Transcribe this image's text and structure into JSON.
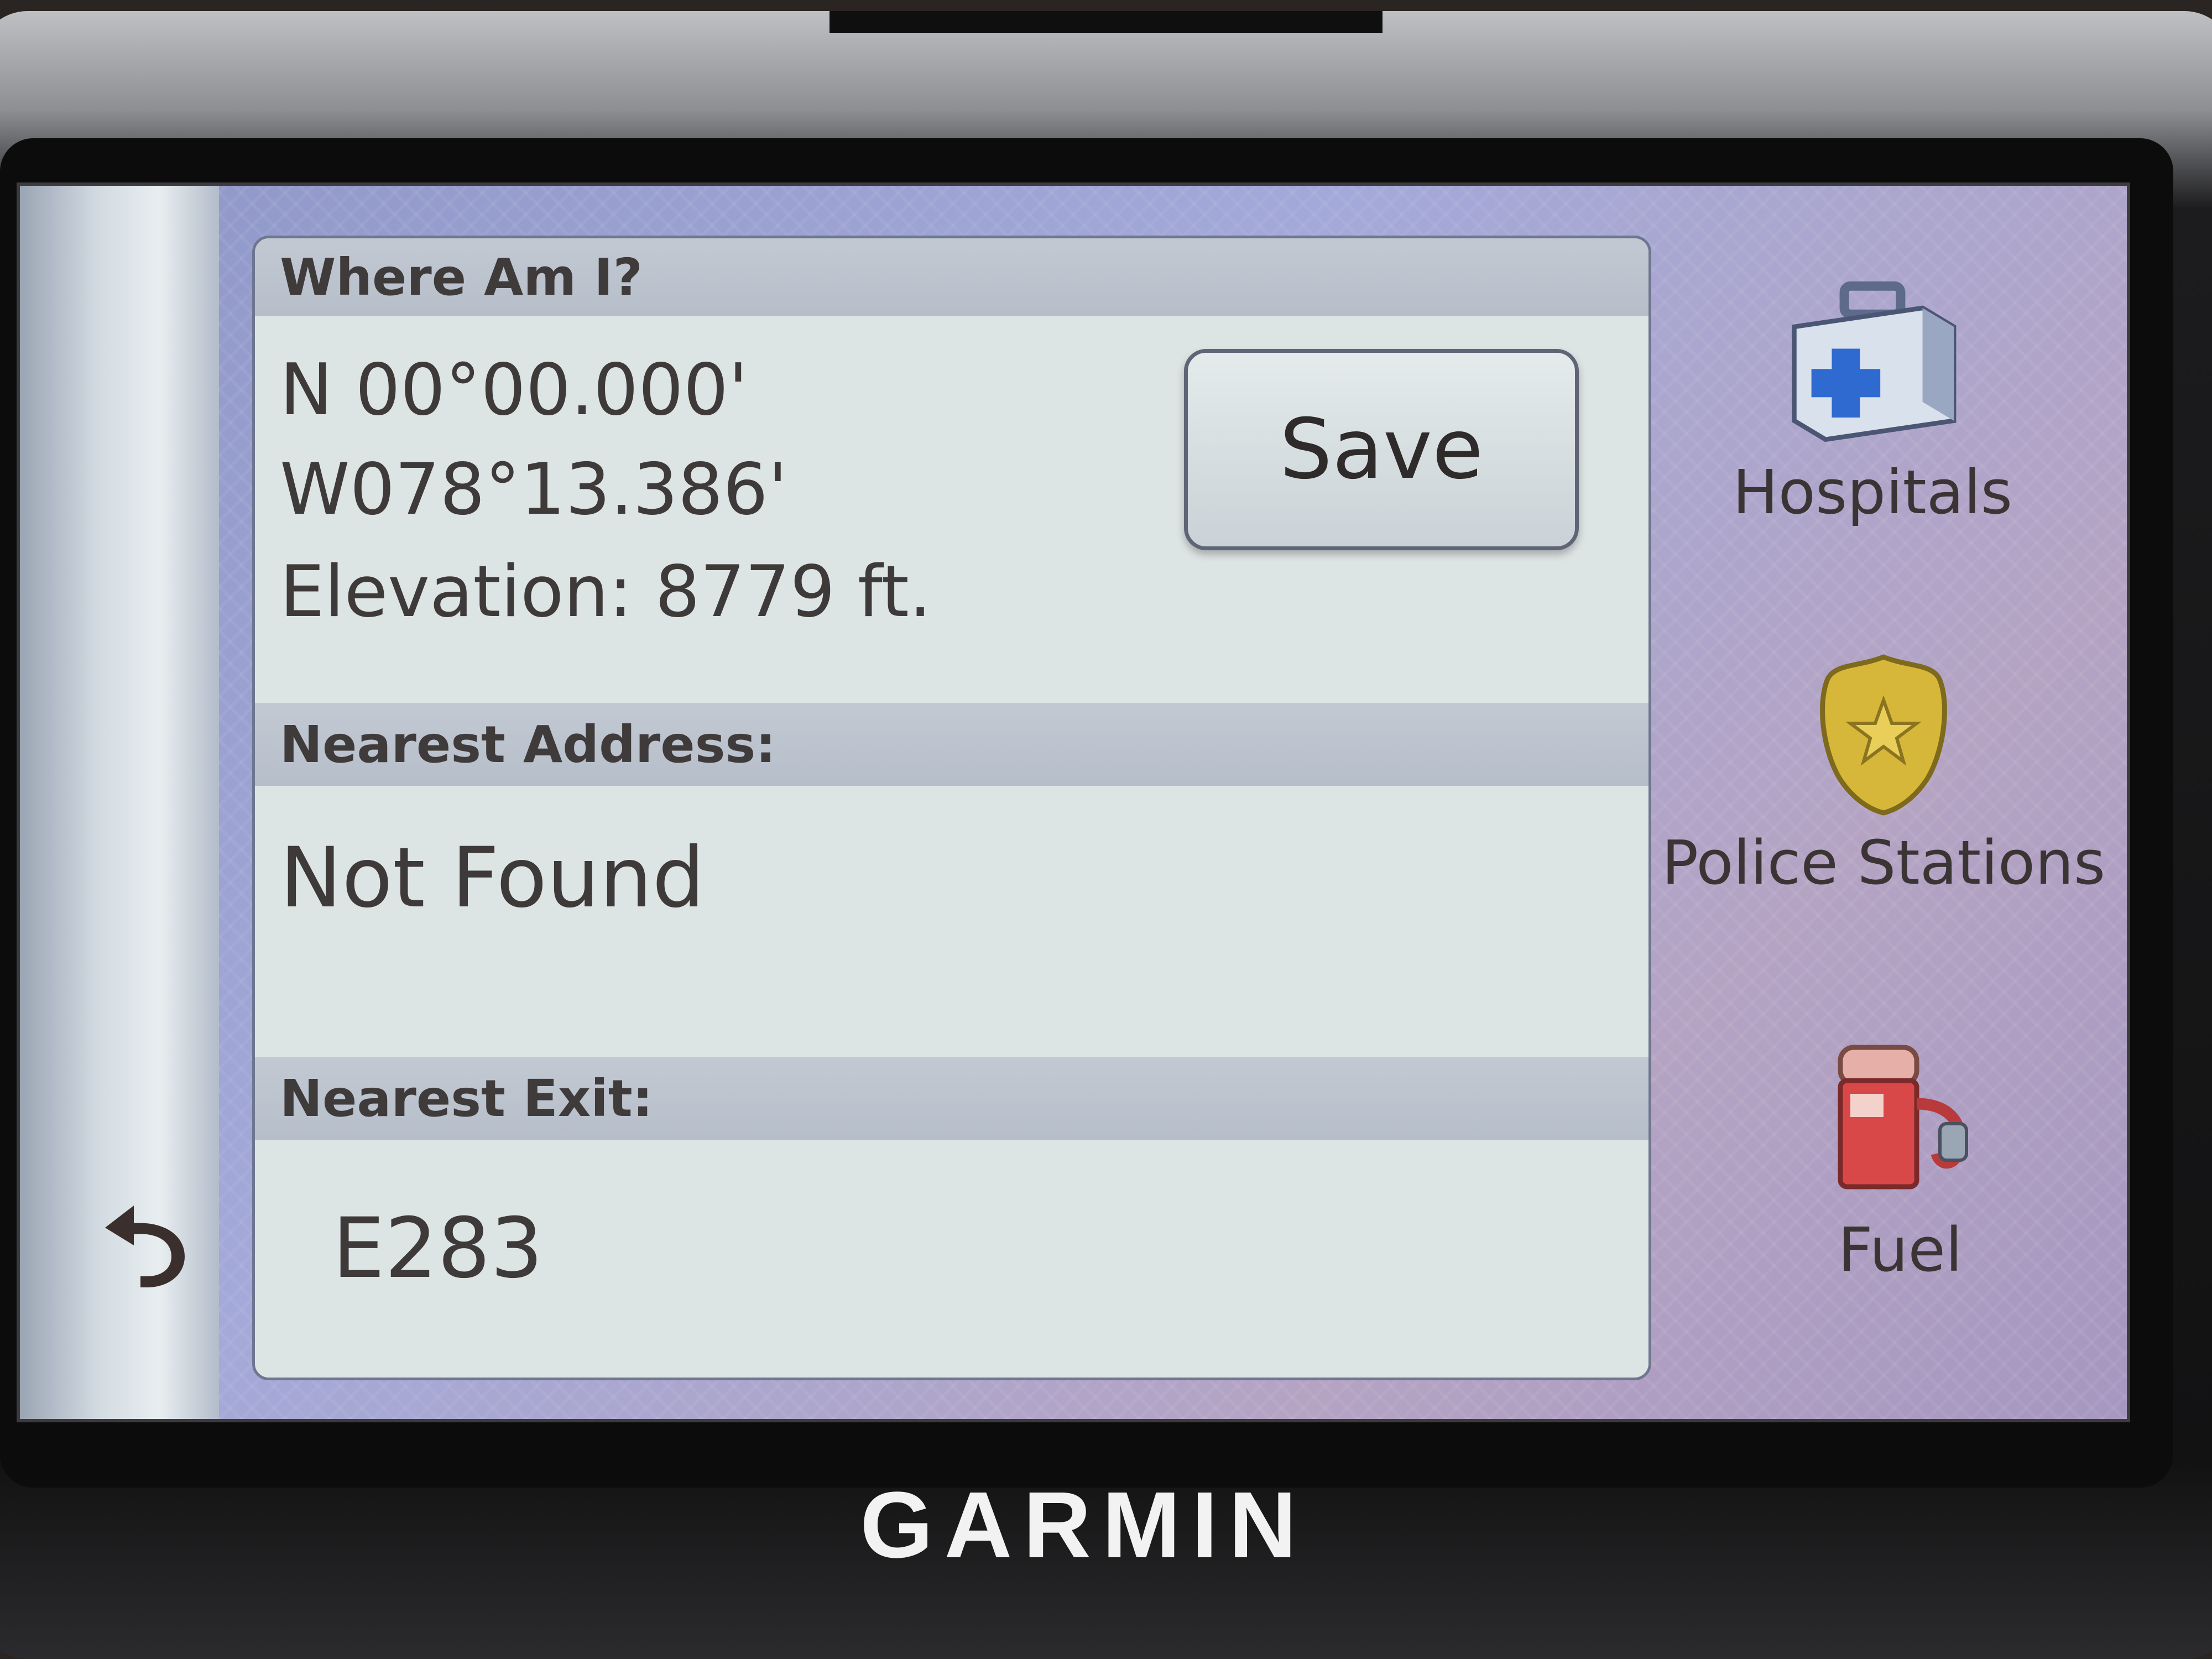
{
  "device": {
    "brand": "GARMIN"
  },
  "panel": {
    "where_header": "Where Am I?",
    "latitude": "N 00°00.000'",
    "longitude": "W078°13.386'",
    "elevation": "Elevation: 8779 ft.",
    "save_label": "Save",
    "address_header": "Nearest Address:",
    "address_value": "Not Found",
    "exit_header": "Nearest Exit:",
    "exit_value": "E283"
  },
  "sidebar": {
    "items": [
      {
        "label": "Hospitals",
        "icon": "first-aid-kit-icon"
      },
      {
        "label": "Police Stations",
        "icon": "police-badge-icon"
      },
      {
        "label": "Fuel",
        "icon": "fuel-pump-icon"
      }
    ]
  },
  "colors": {
    "screen_background": "#a3a9d8",
    "panel_background": "#dde5e4",
    "header_band": "#b6bec9",
    "text": "#3f3a3a"
  }
}
